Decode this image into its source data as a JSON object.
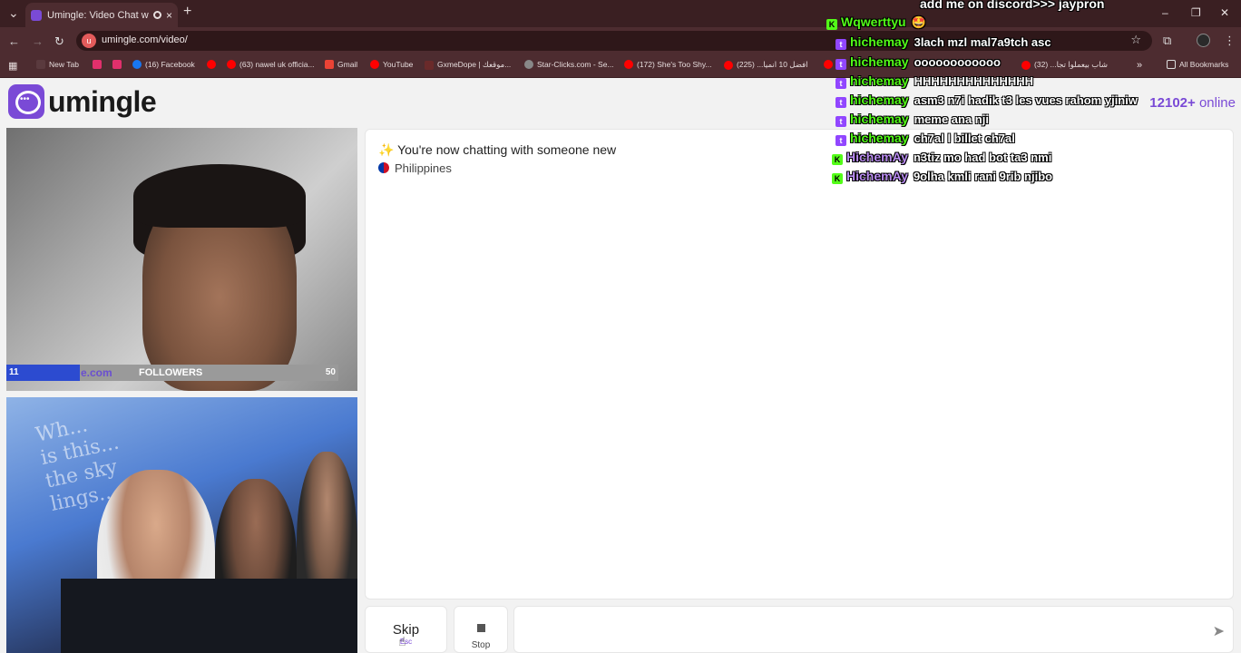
{
  "browser": {
    "tab_title": "Umingle: Video Chat with S",
    "tab_close": "×",
    "new_tab": "+",
    "tab_search": "⌄",
    "url": "umingle.com/video/",
    "site_icon_letter": "u",
    "window": {
      "minimize": "–",
      "maximize": "❐",
      "close": "✕"
    },
    "nav": {
      "back": "←",
      "forward": "→",
      "reload": "↻"
    },
    "bookmarks": [
      {
        "label": "New Tab",
        "color": "#5a3a3e"
      },
      {
        "label": "",
        "color": "#e1306c"
      },
      {
        "label": "",
        "color": "#e1306c"
      },
      {
        "label": "(16) Facebook",
        "color": "#1877f2"
      },
      {
        "label": "",
        "color": "#ff0000"
      },
      {
        "label": "(63) nawel uk officia...",
        "color": "#ff0000"
      },
      {
        "label": "Gmail",
        "color": "#ea4335"
      },
      {
        "label": "YouTube",
        "color": "#ff0000"
      },
      {
        "label": "GxmeDope | موقعك...",
        "color": "#6a2a2a"
      },
      {
        "label": "Star-Clicks.com - Se...",
        "color": "#888888"
      },
      {
        "label": "(172) She's Too Shy...",
        "color": "#ff0000"
      },
      {
        "label": "افضل 10 انميا... (225)",
        "color": "#ff0000"
      },
      {
        "label": "",
        "color": "#ff0000"
      },
      {
        "label": "شاب بيعملوا تجا... (32)",
        "color": "#ff0000"
      }
    ],
    "more_bookmarks": "»",
    "all_bookmarks": "All Bookmarks"
  },
  "site": {
    "logo_text": "umingle",
    "online_count": "12102+",
    "online_label": "online"
  },
  "video1_overlay": {
    "left_count": "11",
    "site_tag": "e.com",
    "label": "FOLLOWERS",
    "right_count": "50",
    "progress": 0.22
  },
  "video2": {
    "wall_text": [
      "Wh...",
      "is this...",
      "the sky",
      "lings..."
    ]
  },
  "chat": {
    "system_message": "✨ You're now chatting with someone new",
    "country": "Philippines"
  },
  "controls": {
    "skip_label": "Skip",
    "skip_key": "Esc",
    "stop_label": "Stop",
    "message_placeholder": "",
    "send_icon": "➤"
  },
  "stream_chat": [
    {
      "platform": "",
      "user": "",
      "message": "add me on discord>>> jaypron",
      "user_color": "#ffffff"
    },
    {
      "platform": "kick",
      "user": "Wqwerttyu",
      "message": "🤩",
      "user_color": "#53fc18"
    },
    {
      "platform": "twitch",
      "user": "hichemay",
      "message": "3lach mzl mal7a9tch asc",
      "user_color": "#53fc18"
    },
    {
      "platform": "twitch",
      "user": "hichemay",
      "message": "oooooooooooo",
      "user_color": "#53fc18"
    },
    {
      "platform": "twitch",
      "user": "hichemay",
      "message": "HHHHHHHHHHHHHH",
      "user_color": "#53fc18"
    },
    {
      "platform": "twitch",
      "user": "hichemay",
      "message": "asm3 n7i hadik t3 les vues rahom yjiniw",
      "user_color": "#53fc18"
    },
    {
      "platform": "twitch",
      "user": "hichemay",
      "message": "meme ana nji",
      "user_color": "#53fc18"
    },
    {
      "platform": "twitch",
      "user": "hichemay",
      "message": "ch7al l billet ch7al",
      "user_color": "#53fc18"
    },
    {
      "platform": "kick",
      "user": "HichemAy",
      "message": "n3tiz mo had bot ta3 nmi",
      "user_color": "#b98cf0"
    },
    {
      "platform": "kick",
      "user": "HichemAy",
      "message": "9olha kmli rani 9rib njibo",
      "user_color": "#b98cf0"
    }
  ]
}
